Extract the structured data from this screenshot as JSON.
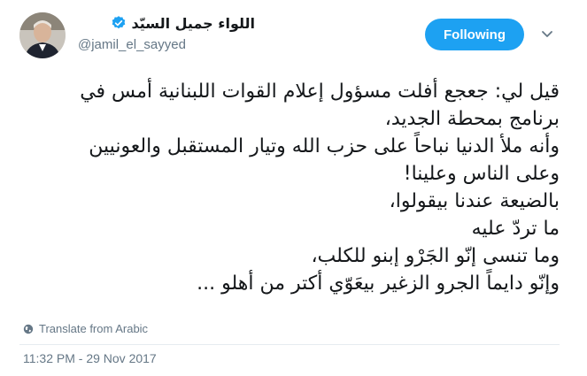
{
  "profile": {
    "display_name": "اللواء جميل السيّد",
    "handle": "@jamil_el_sayyed",
    "verified": true,
    "avatar_icon": "profile-photo"
  },
  "follow_button": {
    "label": "Following",
    "color": "#1da1f2"
  },
  "menu": {
    "icon": "chevron-down-icon"
  },
  "tweet": {
    "lines": [
      "قيل لي: جعجع أفلت مسؤول إعلام القوات اللبنانية أمس في",
      "برنامج  بمحطة الجديد،",
      "وأنه ملأ الدنيا نباحاً على حزب الله وتيار المستقبل والعونيين",
      "وعلى الناس وعلينا!",
      "بالضيعة عندنا بيقولوا،",
      "ما تردّ عليه",
      "وما تنسى إنّو الجَرْو إبنو للكلب،",
      "وإنّو دايماً الجرو الزغير بيعَوّي أكتر من أهلو ..."
    ]
  },
  "translate": {
    "label": "Translate from Arabic",
    "icon": "globe-icon"
  },
  "timestamp": "11:32 PM - 29 Nov 2017"
}
